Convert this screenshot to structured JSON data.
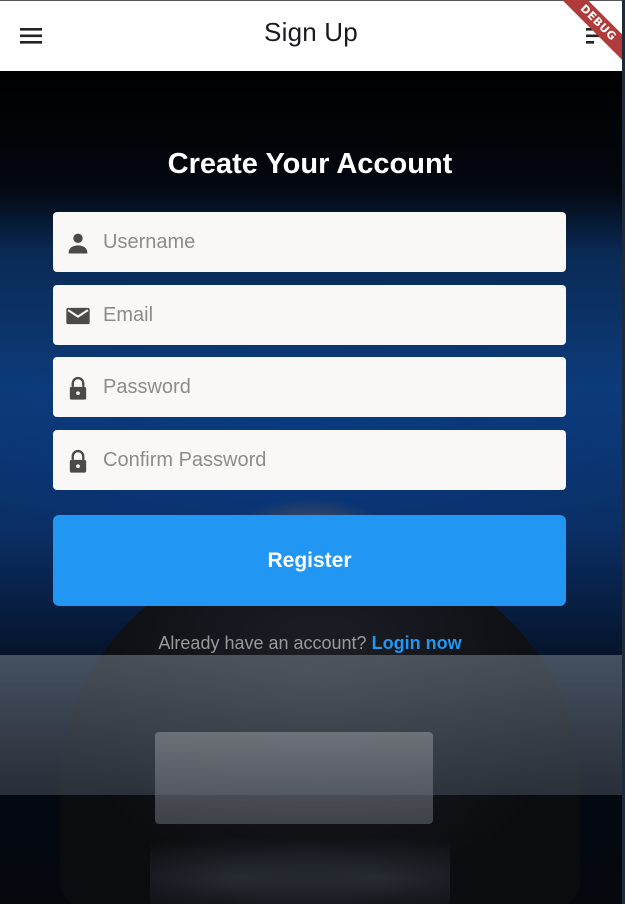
{
  "appbar": {
    "title": "Sign Up",
    "left_icon": "menu-icon",
    "right_icon": "sort-icon",
    "debug_label": "DEBUG"
  },
  "form": {
    "heading": "Create Your Account",
    "fields": [
      {
        "icon": "person-icon",
        "placeholder": "Username",
        "value": ""
      },
      {
        "icon": "email-icon",
        "placeholder": "Email",
        "value": ""
      },
      {
        "icon": "lock-icon",
        "placeholder": "Password",
        "value": ""
      },
      {
        "icon": "lock-icon",
        "placeholder": "Confirm Password",
        "value": ""
      }
    ],
    "register_label": "Register",
    "login_prompt": "Already have an account?",
    "login_link": "Login now"
  },
  "colors": {
    "accent": "#2196f3",
    "field_bg": "#faf8f7",
    "appbar_bg": "#ffffff",
    "debug_ribbon": "#b13b3b"
  }
}
